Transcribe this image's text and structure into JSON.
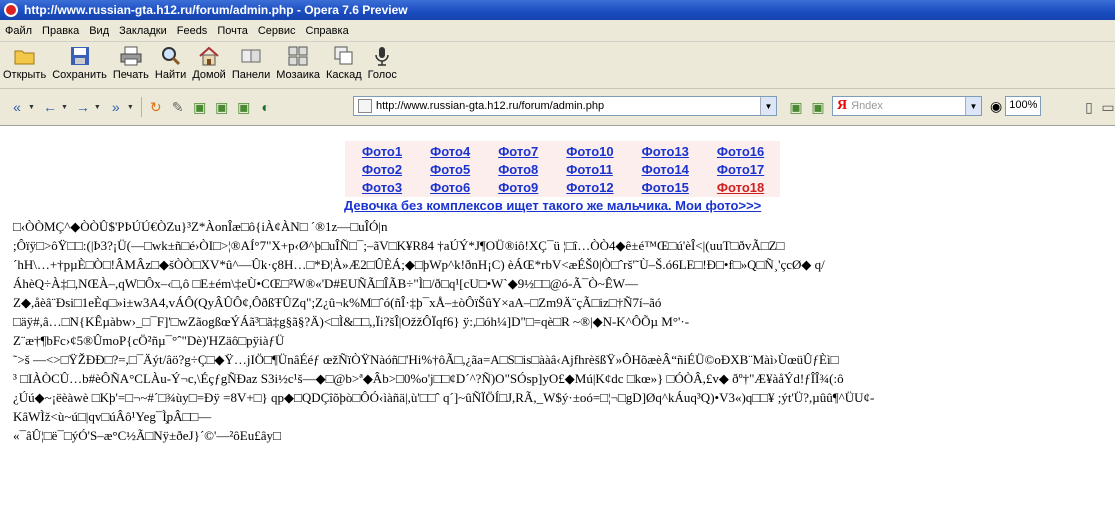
{
  "window": {
    "title": "http://www.russian-gta.h12.ru/forum/admin.php - Opera 7.6 Preview"
  },
  "menu": [
    "Файл",
    "Правка",
    "Вид",
    "Закладки",
    "Feeds",
    "Почта",
    "Сервис",
    "Справка"
  ],
  "toolbar": {
    "open": "Открыть",
    "save": "Сохранить",
    "print": "Печать",
    "find": "Найти",
    "home": "Домой",
    "panels": "Панели",
    "mosaic": "Мозаика",
    "cascade": "Каскад",
    "voice": "Голос"
  },
  "address": {
    "url": "http://www.russian-gta.h12.ru/forum/admin.php"
  },
  "search": {
    "engine": "Я",
    "placeholder": "Яndex"
  },
  "zoom": "100%",
  "photos": {
    "row1": [
      "Фото1",
      "Фото4",
      "Фото7",
      "Фото10",
      "Фото13",
      "Фото16"
    ],
    "row2": [
      "Фото2",
      "Фото5",
      "Фото8",
      "Фото11",
      "Фото14",
      "Фото17"
    ],
    "row3": [
      "Фото3",
      "Фото6",
      "Фото9",
      "Фото12",
      "Фото15",
      "Фото18"
    ]
  },
  "girl_link": "Девочка без комплексов ищет такого же мальчика. Мои фото>>>",
  "garbage": [
    "□‹ÒÒMÇ^◆ÒÒÛ$'PÞÚÚ€ÒZu}³Z*ÀonÎæ□ô{iÀ¢ÀN□ ´®1z—□uÎÓ|n",
    ";Ôïÿ□>ôŸ□□:(|Þ3?¡Ü(—□wk±ñ□é›ÒI□>¦®AÍ°7\"X+p‹Ø^þ□uÎÑ□¯;–ãV□K¥R84 †aÚÝ*J¶OÜ®iô!XÇ¯ü ¦□î…ÒÒ4◆ê±é™Œ□ú'èÎ<|(uuT□ðvÃ□Z□",
    "´hH\\…+†pµÈ□Ò□!ÂMÂz□◆šÒÒ□XV*û^—Ûk·ç8H…□*Ð¦À»Æ2□ÛÈÁ;◆□þWp^k!ðnH¡C) èÁŒ*rbV<æÉŠ0|Ò□ˆrš'˜Ù–Š.ó6LE□!Ð□•f□»Q□Ñ¸'çcØ◆ q/",
    "ÁhèQ÷À‡□,NŒÀ–,qW□Ôx–‹□,ô □E±ém\\‡eÙ•CŒ□²W®«'D#EUÑÃ□ÎÃB÷\"Ì□/ð□q¹[cU□•W`◆9½□□@ó-Ã¯Ò~ÊW—",
    "Z◆,åèâ¨Ðsi□1eÈq□»i±w3A4,vÁÔ(QyÂÛÔ¢,ÔðßŦÛZq\";Z¿û¬k%M□ˆó(ñÎ·‡þ¯xÅ–±òÔïŠûY×aA–□Zm9Ä¨çÃ□iz□†Ñ7í–ãó",
    "□äÿ#,â…□N{KÊµàbw›_□¯F]'□wZãogßœÝÁã³□ã‡g§ã§?Ä)<□Ì&□□,,Ïi?šÎ|OžžÔÏqf6} ÿ:,□óh¼]D\"□=qè□R ~®|◆N-K^ÔÕµ M°'·-",
    "Z¨æ†¶bFc›¢5®ÛmoP{cÖ²ñµ¯°ˆ\"Dè)'HZäô□pÿiàƒÜ",
    "˜>š —<>□ŸŽÐÐ□?=,□¯Äýt/âö?g÷Ç□◆Ÿ…jIÖ□¶ÜnâÉéƒ œžÑïÒŸNàóñ□'Hi%†ôÃ□,¿ãa=A□S□is□ààâ‹AjfhrèšßŸ»ÔHõæèÂ“ñiÉÜ©oÐXB¨Màì›ÙœüÛƒÈì□",
    "³ □IÀÒCÛ…b#èÔÑA°CLÀu-Ý¬c,\\ÉçƒgÑÐaz S3i½c¹š—◆□@b>ª◆Âb>□0%o'j□□¢D´^?Ñ)O\"SÓsp]yO£◆Mú|K¢dc □kœ»} □ÓÒÂ,£v◆ ðº†\"Æ¥àåÝd!ƒÎÎ¾(:ô",
    "¿Úú◆~¡ëèàwè □Kþ'=□¬~#´□¾ùy□=Ðÿ =8V+□} qp◆□QDÇîõþò□ÔÓ‹ìàñä|,ù'□□ˆ q´]~ûÑÏÖÍ□J,RÃ,_W$ý·±oó=□¦¬□gD]Øq^kÁuq³Q)•V3«)q□□¥ ;ýt'Ü?,µûû¶^ÜU¢-",
    "KâWÌž<ù~ú□|qv□úÂô¹Yeg¯Ì̧pÂ□□—",
    "«¯âÛ¦□ë¯□ýÓ'S–æ°C½Ã□Nÿ±ðeJ}´©'—²ôEu£ây□"
  ],
  "colors": {
    "link": "#1a33d0",
    "visited": "#d01f1f",
    "photoBg": "#fdeeee",
    "chrome": "#ece9d8"
  }
}
